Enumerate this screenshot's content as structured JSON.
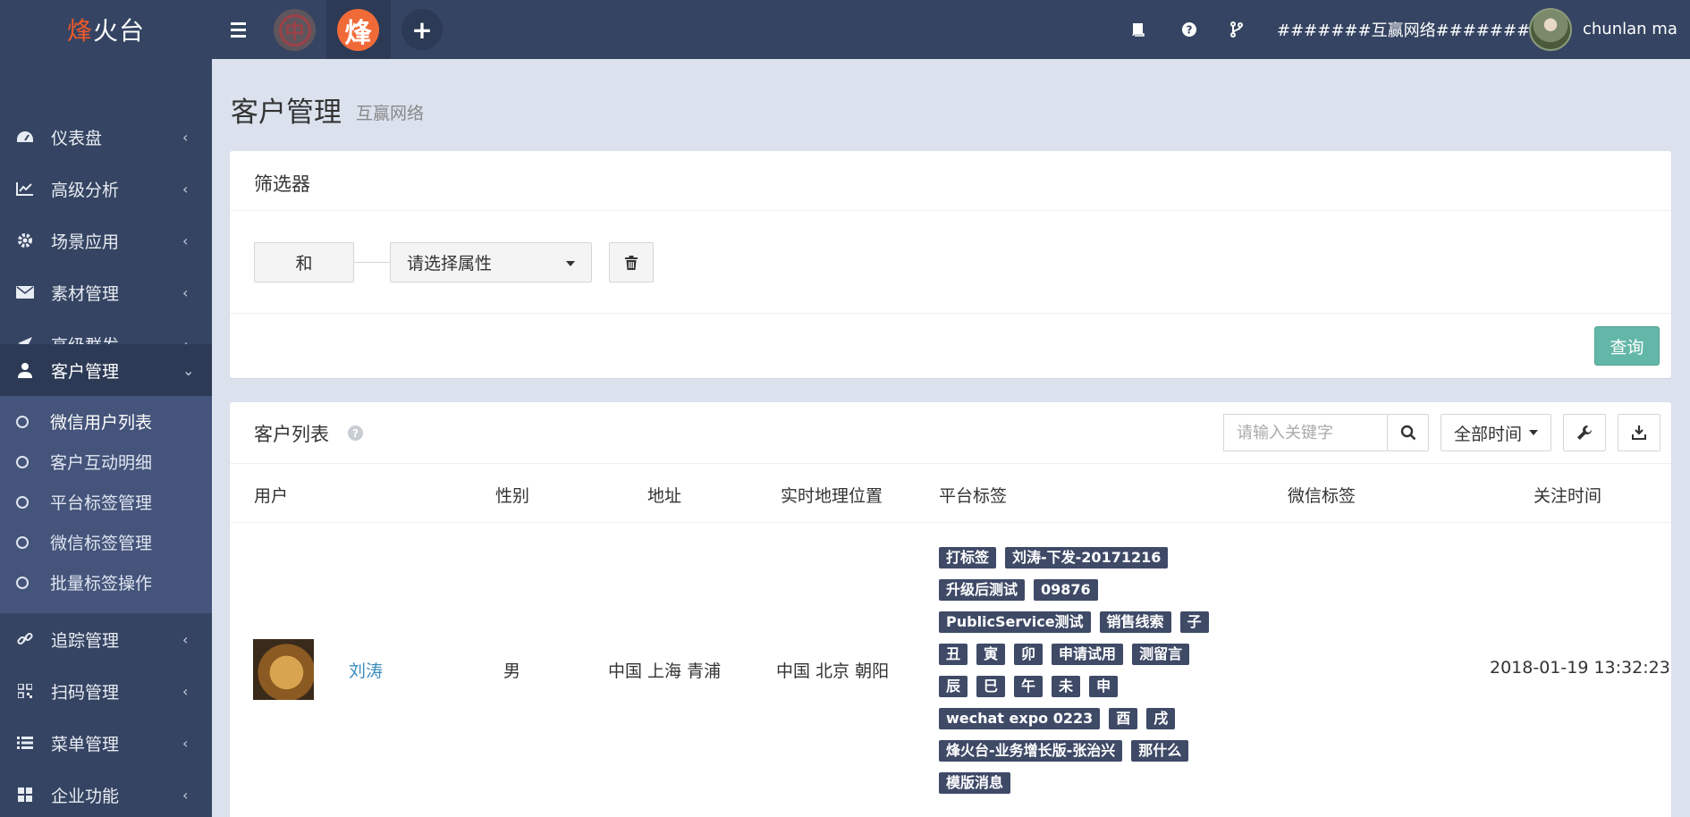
{
  "brand": {
    "logo_highlight": "烽",
    "logo_rest": "火台"
  },
  "topbar": {
    "account_1_letter": "中",
    "account_2_letter": "烽",
    "add_label": "+",
    "org_name": "#######互赢网络#######",
    "user_name": "chunlan ma"
  },
  "sidebar": {
    "items": [
      {
        "label": "仪表盘",
        "icon": "dashboard-icon"
      },
      {
        "label": "高级分析",
        "icon": "line-chart-icon"
      },
      {
        "label": "场景应用",
        "icon": "gear-icon"
      },
      {
        "label": "素材管理",
        "icon": "envelope-icon"
      },
      {
        "label": "高级群发",
        "icon": "paper-plane-icon"
      },
      {
        "label": "客户管理",
        "icon": "user-icon"
      },
      {
        "label": "追踪管理",
        "icon": "link-icon"
      },
      {
        "label": "扫码管理",
        "icon": "qrcode-icon"
      },
      {
        "label": "菜单管理",
        "icon": "list-icon"
      },
      {
        "label": "企业功能",
        "icon": "grid-icon"
      }
    ],
    "submenu": [
      {
        "label": "微信用户列表"
      },
      {
        "label": "客户互动明细"
      },
      {
        "label": "平台标签管理"
      },
      {
        "label": "微信标签管理"
      },
      {
        "label": "批量标签操作"
      }
    ]
  },
  "page": {
    "title": "客户管理",
    "subtitle": "互赢网络"
  },
  "filter": {
    "title": "筛选器",
    "and_label": "和",
    "select_placeholder": "请选择属性",
    "query_label": "查询"
  },
  "list": {
    "title": "客户列表",
    "help": "?",
    "search_placeholder": "请输入关键字",
    "time_label": "全部时间",
    "columns": [
      "用户",
      "性别",
      "地址",
      "实时地理位置",
      "平台标签",
      "微信标签",
      "关注时间"
    ],
    "rows": [
      {
        "name": "刘涛",
        "gender": "男",
        "address": "中国 上海 青浦",
        "location": "中国 北京 朝阳",
        "wechat_tags": "",
        "follow_time": "2018-01-19 13:32:23",
        "tag_lines": [
          [
            "打标签",
            "刘涛-下发-20171216"
          ],
          [
            "升级后测试",
            "09876"
          ],
          [
            "PublicService测试",
            "销售线索",
            "子"
          ],
          [
            "丑",
            "寅",
            "卯",
            "申请试用",
            "测留言"
          ],
          [
            "辰",
            "巳",
            "午",
            "未",
            "申"
          ],
          [
            "wechat expo 0223",
            "酉",
            "戌"
          ],
          [
            "烽火台-业务增长版-张治兴",
            "那什么"
          ],
          [
            "模版消息"
          ]
        ]
      }
    ]
  }
}
